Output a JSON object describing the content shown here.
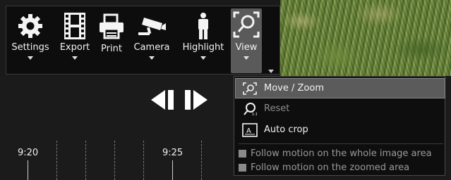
{
  "toolbar": {
    "settings_label": "Settings",
    "export_label": "Export",
    "print_label": "Print",
    "camera_label": "Camera",
    "highlight_label": "Highlight",
    "view_label": "View"
  },
  "playback": {
    "prev_icon": "step-back-icon",
    "next_icon": "step-forward-icon"
  },
  "timeline": {
    "labels": [
      "9:20",
      "9:25"
    ]
  },
  "view_menu": {
    "move_zoom": "Move / Zoom",
    "reset": "Reset",
    "auto_crop": "Auto crop",
    "follow_whole": "Follow motion on the whole image area",
    "follow_zoomed": "Follow motion on the zoomed area",
    "follow_whole_checked": false,
    "follow_zoomed_checked": false
  },
  "colors": {
    "toolbar_bg": "#0d0d0d",
    "active_bg": "#5a5a5a",
    "menu_bg": "#0e0e0e",
    "disabled_text": "#8d8d8d"
  }
}
